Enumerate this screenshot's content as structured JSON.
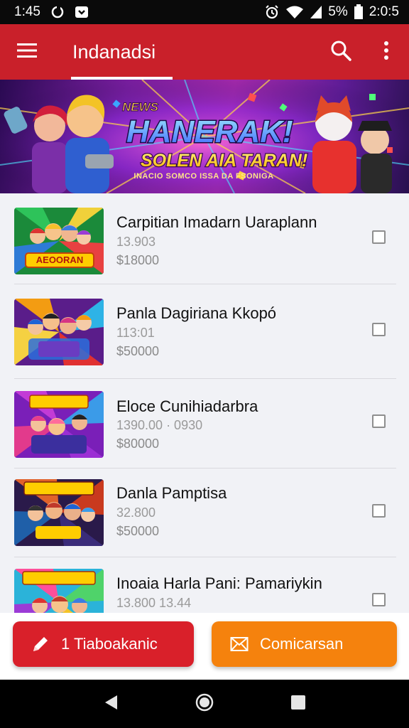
{
  "status_bar": {
    "time_left": "1:45",
    "battery_percent": "5%",
    "time_right": "2:0:5",
    "icons": [
      "sync-icon",
      "app-notification-icon",
      "alarm-icon",
      "wifi-icon",
      "signal-icon",
      "battery-icon"
    ]
  },
  "app_bar": {
    "title": "Indanadsi",
    "icons": [
      "menu-icon",
      "search-icon",
      "more-vert-icon"
    ],
    "color": "#c9202a"
  },
  "banner": {
    "kicker": "NEWS",
    "headline": "HANERAK!",
    "subheadline": "SOLEN AIA TARAN!",
    "tagline": "INACIO SOMCO ISSA DA FSONIGA"
  },
  "items": [
    {
      "title": "Carpitian Imadarn Uaraplann",
      "meta": "13.903",
      "price": "$18000",
      "thumb_label": "AEOORAN",
      "checked": false
    },
    {
      "title": "Panla Dagiriana Kkopó",
      "meta": "113:01",
      "price": "$50000",
      "thumb_label": "",
      "checked": false
    },
    {
      "title": "Eloce Cunihiadarbra",
      "meta": "1390.00 · 0930",
      "price": "$80000",
      "thumb_label": "",
      "checked": false
    },
    {
      "title": "Danla Pamptisa",
      "meta": "32.800",
      "price": "$50000",
      "thumb_label": "TNGBOAS",
      "checked": false
    },
    {
      "title": "Inoaia Harla Pani: Pamariykin",
      "meta": "13.800   13.44",
      "price": "",
      "thumb_label": "TAGBOAS",
      "checked": false
    }
  ],
  "actions": {
    "primary_label": "1 Tiaboakanic",
    "primary_icon": "pencil-icon",
    "primary_color": "#d9202a",
    "secondary_label": "Comicarsan",
    "secondary_icon": "mail-icon",
    "secondary_color": "#f5820d"
  },
  "nav_bar": {
    "icons": [
      "back-icon",
      "home-icon",
      "recents-icon"
    ]
  }
}
